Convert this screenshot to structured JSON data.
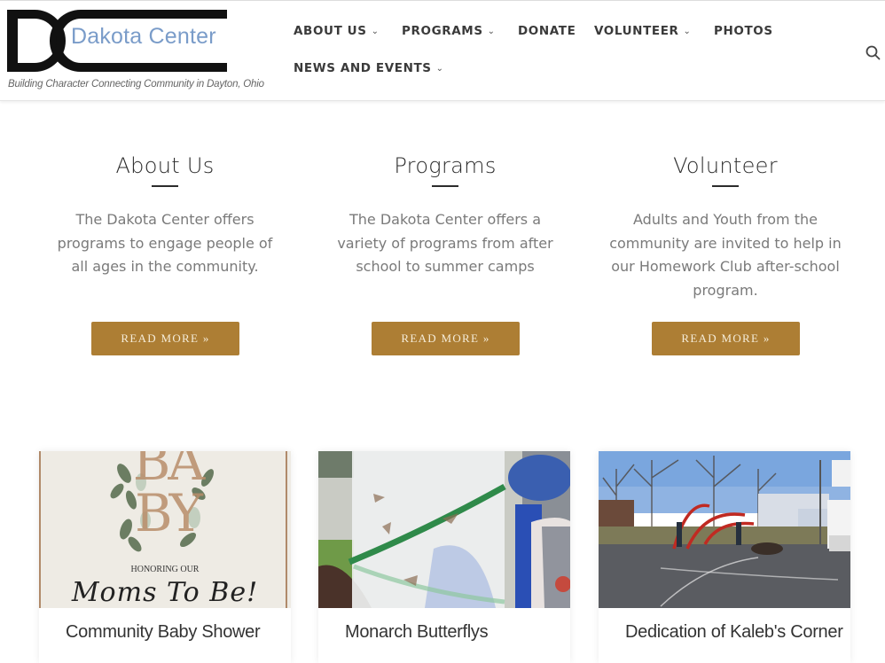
{
  "header": {
    "logo_text": "Dakota Center",
    "logo_mark": "DC",
    "tagline": "Building Character Connecting Community in Dayton, Ohio",
    "nav": [
      {
        "label": "ABOUT US",
        "has_dropdown": true
      },
      {
        "label": "PROGRAMS",
        "has_dropdown": true
      },
      {
        "label": "DONATE",
        "has_dropdown": false
      },
      {
        "label": "VOLUNTEER",
        "has_dropdown": true
      },
      {
        "label": "PHOTOS",
        "has_dropdown": false
      },
      {
        "label": "NEWS AND EVENTS",
        "has_dropdown": true
      }
    ],
    "chevron": "⌄",
    "search_icon": "search-icon"
  },
  "features": [
    {
      "title": "About Us",
      "text": "The Dakota Center offers programs to engage people of all ages in the community.",
      "button": "READ MORE »"
    },
    {
      "title": "Programs",
      "text": "The Dakota Center offers a variety of programs from after school to summer camps",
      "button": "READ MORE »"
    },
    {
      "title": "Volunteer",
      "text": "Adults and Youth from the community are invited to help in our Homework Club after-school program.",
      "button": "READ MORE »"
    }
  ],
  "cards": [
    {
      "title": "Community Baby Shower",
      "image": {
        "big_text_1": "BA",
        "big_text_2": "BY",
        "line": "HONORING OUR",
        "script": "Moms To Be!"
      }
    },
    {
      "title": "Monarch Butterflys",
      "image": {}
    },
    {
      "title": "Dedication of Kaleb's Corner",
      "image": {}
    }
  ],
  "colors": {
    "accent": "#ad7e34",
    "logo_blue": "#7a9cc9",
    "text_dark": "#2c2c2c",
    "text_muted": "#7a7a7a"
  }
}
